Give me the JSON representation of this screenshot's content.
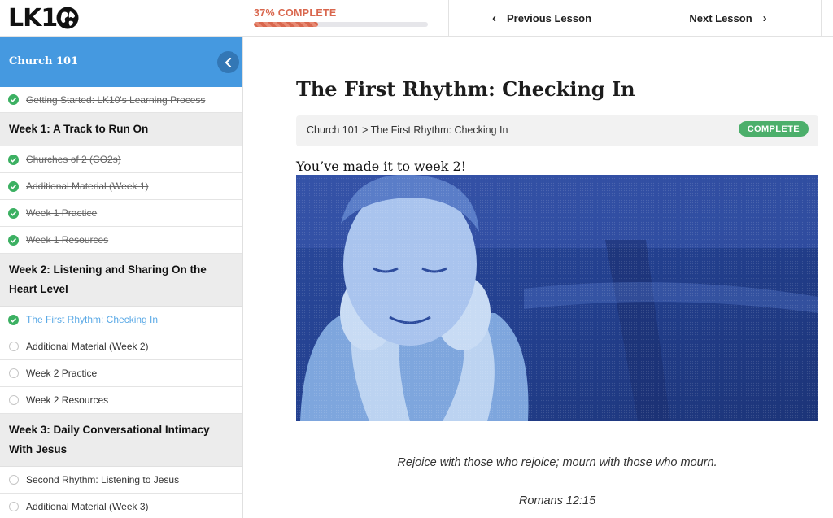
{
  "logo": {
    "text": "LK1"
  },
  "progress": {
    "label": "37% COMPLETE",
    "fraction": 0.37
  },
  "nav": {
    "previous": "Previous Lesson",
    "next": "Next Lesson"
  },
  "sidebar": {
    "course_title": "Church 101",
    "getting_started": "Getting Started: LK10's Learning Process",
    "week1": {
      "heading": "Week 1: A Track to Run On",
      "items": [
        "Churches of 2 (CO2s)",
        "Additional Material (Week 1)",
        "Week 1 Practice",
        "Week 1 Resources"
      ]
    },
    "week2": {
      "heading": "Week 2: Listening and Sharing On the Heart Level",
      "items": [
        "The First Rhythm: Checking In",
        "Additional Material (Week 2)",
        "Week 2 Practice",
        "Week 2 Resources"
      ]
    },
    "week3": {
      "heading": "Week 3: Daily Conversational Intimacy With Jesus",
      "items": [
        "Second Rhythm: Listening to Jesus",
        "Additional Material (Week 3)"
      ]
    }
  },
  "lesson": {
    "title": "The First Rhythm: Checking In",
    "breadcrumb": "Church 101 > The First Rhythm: Checking In",
    "status_badge": "COMPLETE",
    "intro": "You’ve made it to week 2!",
    "quote": "Rejoice with those who rejoice; mourn with those who mourn.",
    "citation": "Romans 12:15"
  },
  "colors": {
    "accent_blue": "#4599e0",
    "progress_orange": "#d9674e",
    "complete_green": "#4caf6b",
    "check_green": "#3cb062"
  },
  "icons": [
    "globe-icon",
    "chevron-left-icon",
    "chevron-right-icon",
    "collapse-chevron-icon",
    "check-circle-icon",
    "empty-circle-icon"
  ]
}
